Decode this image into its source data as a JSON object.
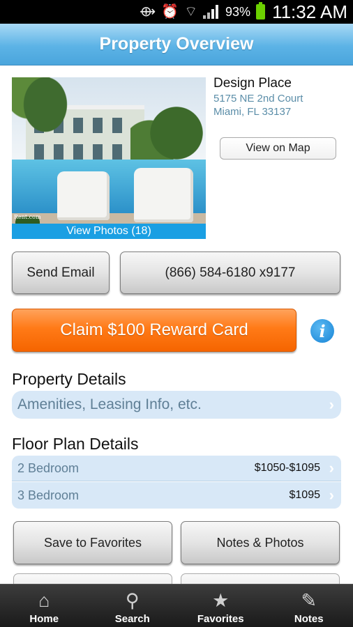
{
  "status_bar": {
    "battery_percent": "93%",
    "time": "11:32 AM",
    "icons": [
      "sync-icon",
      "alarm-icon",
      "wifi-icon",
      "signal-icon",
      "battery-icon"
    ]
  },
  "header": {
    "title": "Property Overview"
  },
  "property": {
    "name": "Design Place",
    "address_line1": "5175 NE 2nd Court",
    "address_line2": "Miami, FL 33137",
    "photo_watermark": "Rent.com",
    "view_photos_label": "View Photos (18)",
    "view_map_label": "View on Map"
  },
  "actions": {
    "email_label": "Send Email",
    "phone_label": "(866) 584-6180 x9177",
    "claim_label": "Claim $100 Reward Card",
    "info_icon": "i"
  },
  "property_details": {
    "title": "Property Details",
    "row_label": "Amenities, Leasing Info, etc."
  },
  "floor_plans": {
    "title": "Floor Plan Details",
    "rows": [
      {
        "label": "2 Bedroom",
        "price": "$1050-$1095"
      },
      {
        "label": "3 Bedroom",
        "price": "$1095"
      }
    ]
  },
  "bottom_actions": {
    "favorites_label": "Save to Favorites",
    "notes_label": "Notes & Photos"
  },
  "tabs": [
    {
      "label": "Home",
      "icon": "home-icon"
    },
    {
      "label": "Search",
      "icon": "search-icon"
    },
    {
      "label": "Favorites",
      "icon": "star-icon"
    },
    {
      "label": "Notes",
      "icon": "pencil-icon"
    }
  ],
  "colors": {
    "header_blue": "#5cb3e6",
    "claim_orange": "#ff7a17",
    "link_blue": "#1a9fe3",
    "row_bg": "#d8e8f7"
  }
}
